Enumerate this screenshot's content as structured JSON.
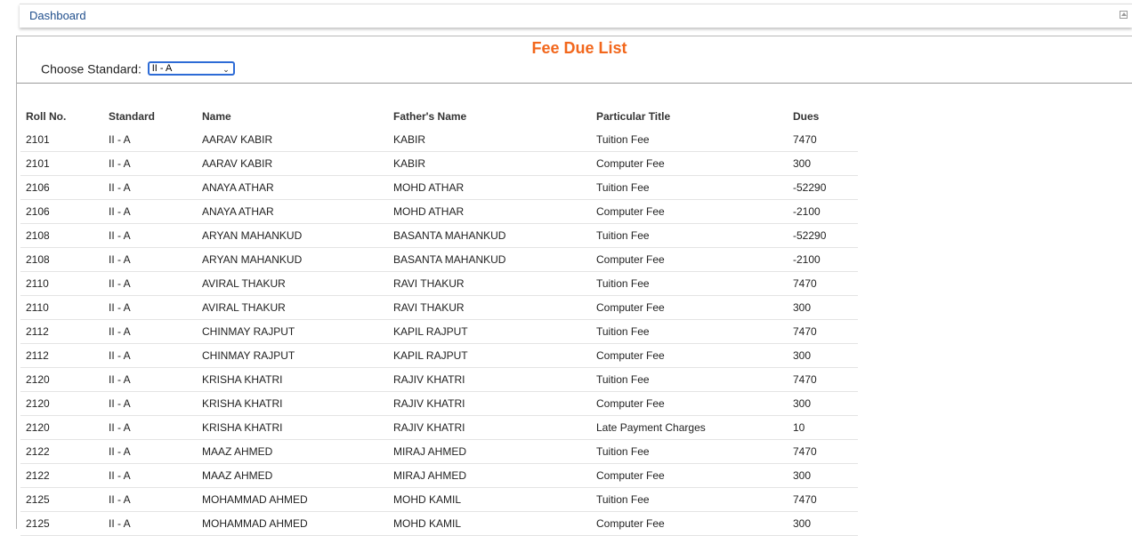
{
  "header": {
    "breadcrumb": "Dashboard"
  },
  "page": {
    "title": "Fee Due List",
    "standard_label": "Choose Standard:",
    "standard_selected": "II - A"
  },
  "table": {
    "columns": [
      "Roll No.",
      "Standard",
      "Name",
      "Father's Name",
      "Particular Title",
      "Dues"
    ],
    "rows": [
      [
        "2101",
        "II - A",
        "AARAV KABIR",
        "KABIR",
        "Tuition Fee",
        "7470"
      ],
      [
        "2101",
        "II - A",
        "AARAV KABIR",
        "KABIR",
        "Computer Fee",
        "300"
      ],
      [
        "2106",
        "II - A",
        "ANAYA ATHAR",
        "MOHD ATHAR",
        "Tuition Fee",
        "-52290"
      ],
      [
        "2106",
        "II - A",
        "ANAYA ATHAR",
        "MOHD ATHAR",
        "Computer Fee",
        "-2100"
      ],
      [
        "2108",
        "II - A",
        "ARYAN MAHANKUD",
        "BASANTA MAHANKUD",
        "Tuition Fee",
        "-52290"
      ],
      [
        "2108",
        "II - A",
        "ARYAN MAHANKUD",
        "BASANTA MAHANKUD",
        "Computer Fee",
        "-2100"
      ],
      [
        "2110",
        "II - A",
        "AVIRAL THAKUR",
        "RAVI THAKUR",
        "Tuition Fee",
        "7470"
      ],
      [
        "2110",
        "II - A",
        "AVIRAL THAKUR",
        "RAVI THAKUR",
        "Computer Fee",
        "300"
      ],
      [
        "2112",
        "II - A",
        "CHINMAY RAJPUT",
        "KAPIL RAJPUT",
        "Tuition Fee",
        "7470"
      ],
      [
        "2112",
        "II - A",
        "CHINMAY RAJPUT",
        "KAPIL RAJPUT",
        "Computer Fee",
        "300"
      ],
      [
        "2120",
        "II - A",
        "KRISHA KHATRI",
        "RAJIV KHATRI",
        "Tuition Fee",
        "7470"
      ],
      [
        "2120",
        "II - A",
        "KRISHA KHATRI",
        "RAJIV KHATRI",
        "Computer Fee",
        "300"
      ],
      [
        "2120",
        "II - A",
        "KRISHA KHATRI",
        "RAJIV KHATRI",
        "Late Payment Charges",
        "10"
      ],
      [
        "2122",
        "II - A",
        "MAAZ AHMED",
        "MIRAJ AHMED",
        "Tuition Fee",
        "7470"
      ],
      [
        "2122",
        "II - A",
        "MAAZ AHMED",
        "MIRAJ AHMED",
        "Computer Fee",
        "300"
      ],
      [
        "2125",
        "II - A",
        "MOHAMMAD AHMED",
        "MOHD KAMIL",
        "Tuition Fee",
        "7470"
      ],
      [
        "2125",
        "II - A",
        "MOHAMMAD AHMED",
        "MOHD KAMIL",
        "Computer Fee",
        "300"
      ]
    ]
  },
  "colors": {
    "title": "#f2671c",
    "dues": "#e00000",
    "link": "#1f4e8c"
  },
  "icons": {
    "collapse": "collapse-icon",
    "dropdown": "chevron-down-icon"
  }
}
